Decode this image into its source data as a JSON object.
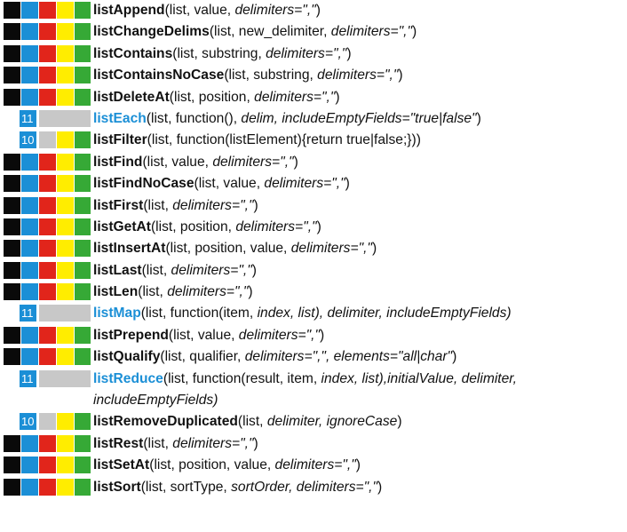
{
  "colors": {
    "black": "#0a0a0a",
    "blue": "#1b8fd6",
    "red": "#e1251b",
    "yellow": "#ffed00",
    "green": "#36a936",
    "gray": "#c8c8c8",
    "v11": "#1b8fd6",
    "v10": "#1b8fd6"
  },
  "functions": [
    {
      "badges": "full",
      "name": "listAppend",
      "args": "(list, value, ",
      "opt": "delimiters=\",\"",
      "end": ")"
    },
    {
      "badges": "full",
      "name": "listChangeDelims",
      "args": "(list, new_delimiter, ",
      "opt": "delimiters=\",\"",
      "end": ")"
    },
    {
      "badges": "full",
      "name": "listContains",
      "args": "(list, substring, ",
      "opt": "delimiters=\",\"",
      "end": ")"
    },
    {
      "badges": "full",
      "name": "listContainsNoCase",
      "args": "(list, substring, ",
      "opt": "delimiters=\",\"",
      "end": ")"
    },
    {
      "badges": "full",
      "name": "listDeleteAt",
      "args": "(list, position, ",
      "opt": "delimiters=\",\"",
      "end": ")"
    },
    {
      "badges": "v11",
      "version": "11",
      "new": true,
      "name": "listEach",
      "args": "(list, function(), ",
      "opt": "delim, includeEmptyFields=\"true|false\"",
      "end": ")"
    },
    {
      "badges": "v10",
      "version": "10",
      "name": "listFilter",
      "args": "(list, function(listElement){return true|false;}))",
      "opt": "",
      "end": ""
    },
    {
      "badges": "full",
      "name": "listFind",
      "args": "(list, value, ",
      "opt": "delimiters=\",\"",
      "end": ")"
    },
    {
      "badges": "full",
      "name": "listFindNoCase",
      "args": "(list, value, ",
      "opt": "delimiters=\",\"",
      "end": ")"
    },
    {
      "badges": "full",
      "name": "listFirst",
      "args": "(list, ",
      "opt": "delimiters=\",\"",
      "end": ")"
    },
    {
      "badges": "full",
      "name": "listGetAt",
      "args": "(list, position, ",
      "opt": "delimiters=\",\"",
      "end": ")"
    },
    {
      "badges": "full",
      "name": "listInsertAt",
      "args": "(list, position, value, ",
      "opt": "delimiters=\",\"",
      "end": ")"
    },
    {
      "badges": "full",
      "name": "listLast",
      "args": "(list, ",
      "opt": "delimiters=\",\"",
      "end": ")"
    },
    {
      "badges": "full",
      "name": "listLen",
      "args": "(list, ",
      "opt": "delimiters=\",\"",
      "end": ")"
    },
    {
      "badges": "v11",
      "version": "11",
      "new": true,
      "name": "listMap",
      "args": "(list, function(item, ",
      "opt": "index, list",
      "end": "), delimiter, includeEmptyFields)",
      "endItalic": true
    },
    {
      "badges": "full",
      "name": "listPrepend",
      "args": "(list, value, ",
      "opt": "delimiters=\",\"",
      "end": ")"
    },
    {
      "badges": "full",
      "name": "listQualify",
      "args": "(list, qualifier, ",
      "opt": "delimiters=\",\", elements=\"all|char\"",
      "end": ")"
    },
    {
      "badges": "v11",
      "version": "11",
      "new": true,
      "tall": true,
      "name": "listReduce",
      "args": "(list, function(result, item, ",
      "opt": "index, list",
      "end": "),initialValue, delimiter, includeEmptyFields)",
      "endItalic": true
    },
    {
      "badges": "v10",
      "version": "10",
      "name": "listRemoveDuplicated",
      "args": "(list, ",
      "opt": "delimiter, ignoreCase",
      "end": ")"
    },
    {
      "badges": "full",
      "name": "listRest",
      "args": "(list, ",
      "opt": "delimiters=\",\"",
      "end": ")"
    },
    {
      "badges": "full",
      "name": "listSetAt",
      "args": "(list, position, value, ",
      "opt": "delimiters=\",\"",
      "end": ")"
    },
    {
      "badges": "full",
      "name": "listSort",
      "args": "(list, sortType, ",
      "opt": "sortOrder, delimiters=\",\"",
      "end": ")"
    }
  ]
}
